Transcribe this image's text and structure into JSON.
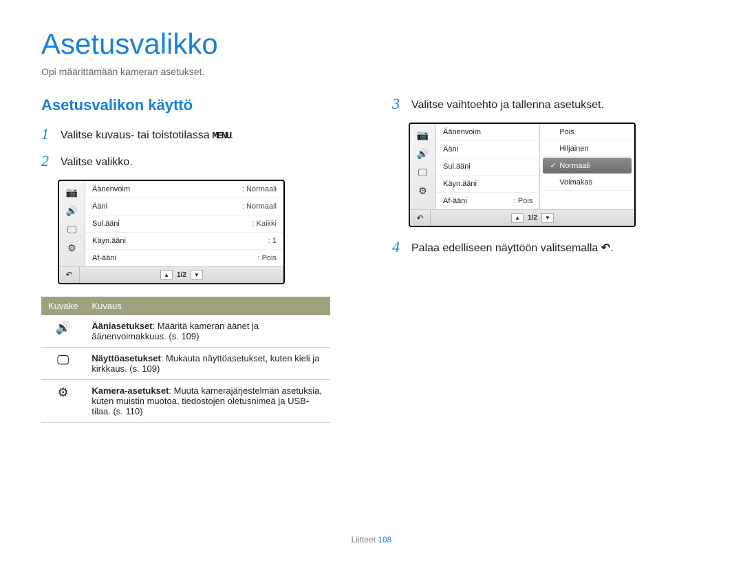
{
  "page": {
    "title": "Asetusvalikko",
    "subtitle": "Opi määrittämään kameran asetukset."
  },
  "section_heading": "Asetusvalikon käyttö",
  "steps": {
    "s1": {
      "num": "1",
      "text_prefix": "Valitse kuvaus- tai toistotilassa ",
      "menu_word": "MENU",
      "text_suffix": "."
    },
    "s2": {
      "num": "2",
      "text": "Valitse valikko."
    },
    "s3": {
      "num": "3",
      "text": "Valitse vaihtoehto ja tallenna asetukset."
    },
    "s4": {
      "num": "4",
      "text_prefix": "Palaa edelliseen näyttöön valitsemalla ",
      "text_suffix": "."
    }
  },
  "cam1": {
    "rows": [
      {
        "label": "Äänenvoim",
        "value": ": Normaali"
      },
      {
        "label": "Ääni",
        "value": ": Normaali"
      },
      {
        "label": "Sul.ääni",
        "value": ": Kaikki"
      },
      {
        "label": "Käyn.ääni",
        "value": ": 1"
      },
      {
        "label": "Af-ääni",
        "value": ": Pois"
      }
    ],
    "pager": "1/2"
  },
  "cam2": {
    "left": [
      {
        "label": "Äänenvoim"
      },
      {
        "label": "Ääni"
      },
      {
        "label": "Sul.ääni"
      },
      {
        "label": "Käyn.ääni"
      },
      {
        "label": "Af-ääni",
        "value": ": Pois"
      }
    ],
    "options": [
      {
        "label": "Pois",
        "selected": false
      },
      {
        "label": "Hiljainen",
        "selected": false
      },
      {
        "label": "Normaali",
        "selected": true
      },
      {
        "label": "Voimakas",
        "selected": false
      }
    ],
    "pager": "1/2"
  },
  "sidebar_icons": [
    "📷",
    "🔊",
    "🖵",
    "⚙"
  ],
  "icon_table": {
    "header": {
      "icon": "Kuvake",
      "desc": "Kuvaus"
    },
    "rows": [
      {
        "icon": "🔊",
        "title": "Ääniasetukset",
        "desc": ": Määritä kameran äänet ja äänenvoimakkuus. (s. 109)"
      },
      {
        "icon": "🖵",
        "title": "Näyttöasetukset",
        "desc": ": Mukauta näyttöasetukset, kuten kieli ja kirkkaus. (s. 109)"
      },
      {
        "icon": "⚙",
        "title": "Kamera-asetukset",
        "desc": ": Muuta kamerajärjestelmän asetuksia, kuten muistin muotoa, tiedostojen oletusnimeä ja USB-tilaa. (s. 110)"
      }
    ]
  },
  "footer": {
    "label": "Liitteet",
    "page": "108"
  }
}
